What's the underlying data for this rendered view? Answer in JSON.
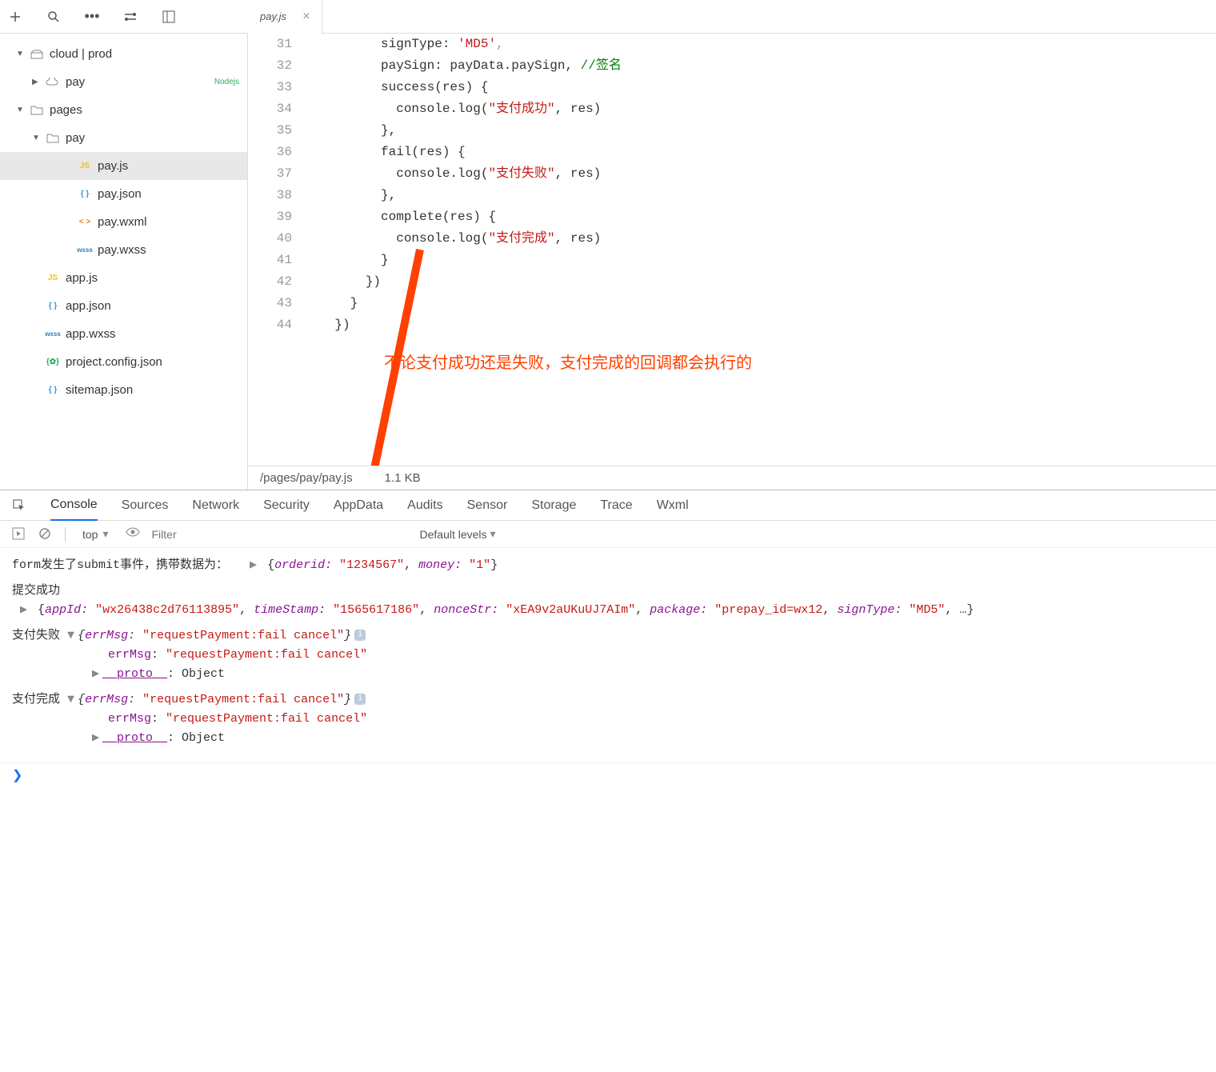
{
  "tab": {
    "filename": "pay.js"
  },
  "sidebar": {
    "items": [
      {
        "chevron": "▼",
        "iconClass": "folder",
        "iconText": "",
        "label": "cloud | prod",
        "indent": 0,
        "folder": true,
        "cloud": true
      },
      {
        "chevron": "▶",
        "iconClass": "cloud",
        "iconText": "",
        "label": "pay",
        "indent": 1,
        "badge": "Nodejs",
        "cloudFn": true
      },
      {
        "chevron": "▼",
        "iconClass": "folder",
        "iconText": "",
        "label": "pages",
        "indent": 0,
        "folder": true
      },
      {
        "chevron": "▼",
        "iconClass": "folder",
        "iconText": "",
        "label": "pay",
        "indent": 1,
        "folder": true
      },
      {
        "chevron": "",
        "iconClass": "js",
        "iconText": "JS",
        "label": "pay.js",
        "indent": 3,
        "active": true
      },
      {
        "chevron": "",
        "iconClass": "json",
        "iconText": "{ }",
        "label": "pay.json",
        "indent": 3
      },
      {
        "chevron": "",
        "iconClass": "wxml",
        "iconText": "< >",
        "label": "pay.wxml",
        "indent": 3
      },
      {
        "chevron": "",
        "iconClass": "wxss",
        "iconText": "wxss",
        "label": "pay.wxss",
        "indent": 3
      },
      {
        "chevron": "",
        "iconClass": "js",
        "iconText": "JS",
        "label": "app.js",
        "indent": 1
      },
      {
        "chevron": "",
        "iconClass": "json",
        "iconText": "{ }",
        "label": "app.json",
        "indent": 1
      },
      {
        "chevron": "",
        "iconClass": "wxss",
        "iconText": "wxss",
        "label": "app.wxss",
        "indent": 1
      },
      {
        "chevron": "",
        "iconClass": "config",
        "iconText": "{✿}",
        "label": "project.config.json",
        "indent": 1
      },
      {
        "chevron": "",
        "iconClass": "json",
        "iconText": "{ }",
        "label": "sitemap.json",
        "indent": 1
      }
    ]
  },
  "code": {
    "startLine": 31,
    "lines": [
      {
        "indent": 10,
        "tokens": [
          {
            "t": "signType: ",
            "c": "default"
          },
          {
            "t": "'MD5'",
            "c": "str"
          },
          {
            "t": ",",
            "c": "mute"
          }
        ]
      },
      {
        "indent": 10,
        "tokens": [
          {
            "t": "paySign: payData.paySign, ",
            "c": "default"
          },
          {
            "t": "//签名",
            "c": "comment"
          }
        ]
      },
      {
        "indent": 10,
        "tokens": [
          {
            "t": "success(res) {",
            "c": "default"
          }
        ]
      },
      {
        "indent": 12,
        "tokens": [
          {
            "t": "console.log(",
            "c": "default"
          },
          {
            "t": "\"支付成功\"",
            "c": "str"
          },
          {
            "t": ", res)",
            "c": "default"
          }
        ]
      },
      {
        "indent": 10,
        "tokens": [
          {
            "t": "},",
            "c": "default"
          }
        ]
      },
      {
        "indent": 10,
        "tokens": [
          {
            "t": "fail(res) {",
            "c": "default"
          }
        ]
      },
      {
        "indent": 12,
        "tokens": [
          {
            "t": "console.log(",
            "c": "default"
          },
          {
            "t": "\"支付失败\"",
            "c": "str"
          },
          {
            "t": ", res)",
            "c": "default"
          }
        ]
      },
      {
        "indent": 10,
        "tokens": [
          {
            "t": "},",
            "c": "default"
          }
        ]
      },
      {
        "indent": 10,
        "tokens": [
          {
            "t": "complete(res) {",
            "c": "default"
          }
        ]
      },
      {
        "indent": 12,
        "tokens": [
          {
            "t": "console.log(",
            "c": "default"
          },
          {
            "t": "\"支付完成\"",
            "c": "str"
          },
          {
            "t": ", res)",
            "c": "default"
          }
        ]
      },
      {
        "indent": 10,
        "tokens": [
          {
            "t": "}",
            "c": "default"
          }
        ]
      },
      {
        "indent": 8,
        "tokens": [
          {
            "t": "})",
            "c": "default"
          }
        ]
      },
      {
        "indent": 6,
        "tokens": [
          {
            "t": "}",
            "c": "default"
          }
        ]
      },
      {
        "indent": 4,
        "tokens": [
          {
            "t": "})",
            "c": "default"
          }
        ]
      }
    ]
  },
  "statusBar": {
    "path": "/pages/pay/pay.js",
    "size": "1.1 KB"
  },
  "annotation": {
    "text": "不论支付成功还是失败，支付完成的回调都会执行的"
  },
  "devtools": {
    "tabs": [
      "Console",
      "Sources",
      "Network",
      "Security",
      "AppData",
      "Audits",
      "Sensor",
      "Storage",
      "Trace",
      "Wxml"
    ],
    "activeTab": "Console",
    "context": "top",
    "filterPlaceholder": "Filter",
    "levels": "Default levels"
  },
  "console": {
    "row1": {
      "prefix": "form发生了submit事件，携带数据为：",
      "obj": [
        {
          "k": "orderid",
          "v": "\"1234567\""
        },
        {
          "k": "money",
          "v": "\"1\""
        }
      ]
    },
    "row2label": "提交成功",
    "row2": [
      {
        "k": "appId",
        "v": "\"wx26438c2d76113895\""
      },
      {
        "k": "timeStamp",
        "v": "\"1565617186\""
      },
      {
        "k": "nonceStr",
        "v": "\"xEA9v2aUKuUJ7AIm\""
      },
      {
        "k": "package",
        "v": "\"prepay_id=wx12"
      },
      {
        "k": "signType",
        "v": "\"MD5\""
      }
    ],
    "row3": {
      "prefix": "支付失败",
      "errKey": "errMsg",
      "errVal": "\"requestPayment:fail cancel\"",
      "expandedKey": "errMsg",
      "expandedVal": "\"requestPayment:fail cancel\"",
      "proto": "__proto__",
      "protoVal": "Object"
    },
    "row4": {
      "prefix": "支付完成",
      "errKey": "errMsg",
      "errVal": "\"requestPayment:fail cancel\"",
      "expandedKey": "errMsg",
      "expandedVal": "\"requestPayment:fail cancel\"",
      "proto": "__proto__",
      "protoVal": "Object"
    }
  }
}
